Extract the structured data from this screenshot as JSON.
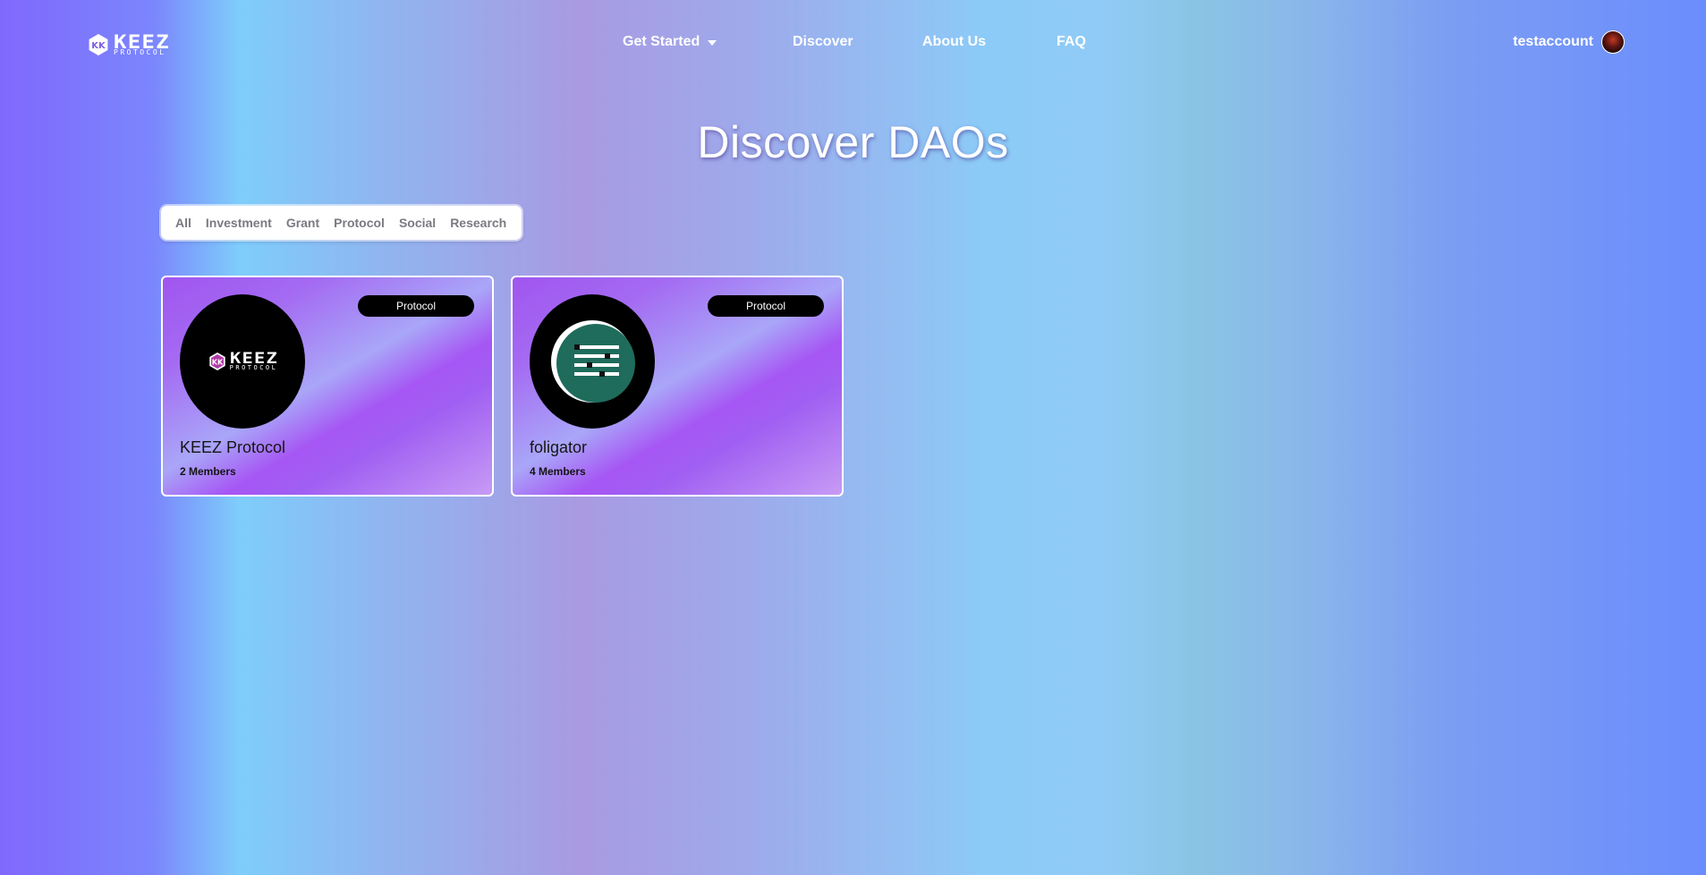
{
  "header": {
    "logo": {
      "big": "KEEZ",
      "small": "PROTOCOL"
    },
    "nav": {
      "get_started": "Get Started",
      "discover": "Discover",
      "about_us": "About Us",
      "faq": "FAQ"
    },
    "user": {
      "name": "testaccount"
    }
  },
  "main": {
    "title": "Discover DAOs",
    "filters": [
      "All",
      "Investment",
      "Grant",
      "Protocol",
      "Social",
      "Research"
    ],
    "cards": [
      {
        "name": "KEEZ Protocol",
        "members": "2 Members",
        "category": "Protocol",
        "logo": {
          "big": "KEEZ",
          "small": "PROTOCOL"
        }
      },
      {
        "name": "foligator",
        "members": "4 Members",
        "category": "Protocol"
      }
    ]
  },
  "colors": {
    "card_gradient_primary": "#a055f0",
    "badge_bg": "#000000",
    "foligator_logo_bg": "#1f6c5c"
  },
  "icons": [
    "keez-logo-icon",
    "chevron-down-icon",
    "user-avatar",
    "keez-protocol-logo-icon",
    "foligator-logo-icon"
  ]
}
